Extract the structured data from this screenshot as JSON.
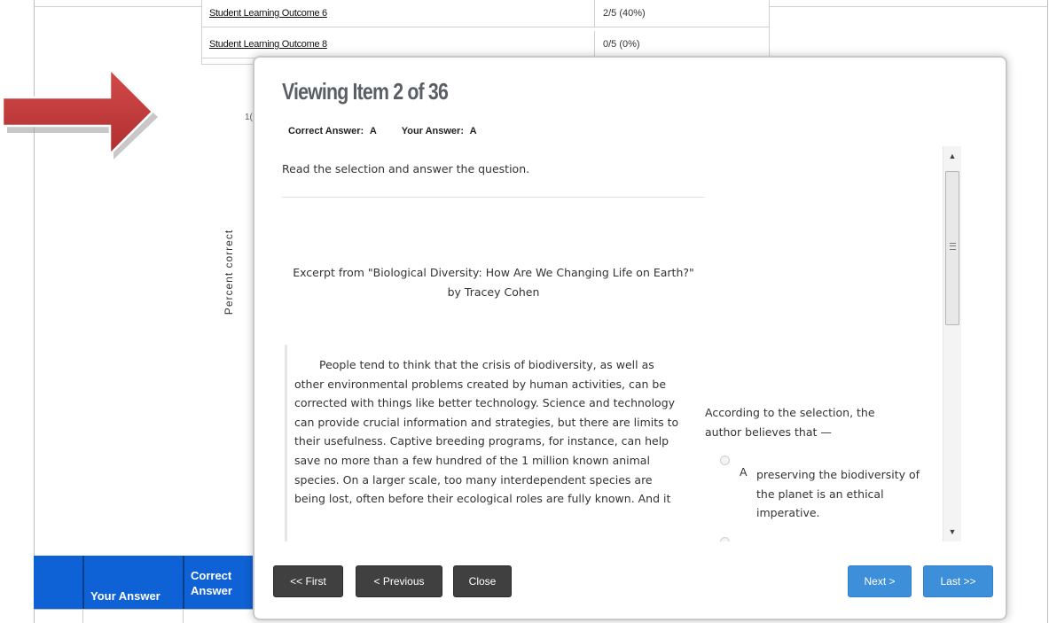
{
  "outcomes": [
    {
      "name": "Student Learning Outcome 6",
      "score": "2/5 (40%)"
    },
    {
      "name": "Student Learning Outcome 8",
      "score": "0/5 (0%)"
    }
  ],
  "chart_fragment": {
    "ylabel": "Percent correct",
    "tick": "1("
  },
  "results_table": {
    "col_your_answer": "Your Answer",
    "col_correct_answer": "Correct Answer"
  },
  "modal": {
    "title": "Viewing Item 2 of 36",
    "correct_answer_label": "Correct Answer:",
    "correct_answer_value": "A",
    "your_answer_label": "Your Answer:",
    "your_answer_value": "A",
    "instruction": "Read the selection and answer the question.",
    "excerpt_title": "Excerpt from \"Biological Diversity: How Are We Changing Life on Earth?\"",
    "excerpt_author": "by Tracey Cohen",
    "passage": "People tend to think that the crisis of biodiversity, as well as other environmental problems created by human activities, can be corrected with things like better technology. Science and technology can provide crucial information and strategies, but there are limits to their usefulness. Captive breeding programs, for instance, can help save no more than a few hundred of the 1 million known animal species. On a larger scale, too many interdependent species are being lost, often before their ecological roles are fully known. And it",
    "question": "According to the selection, the author believes that —",
    "option_a_letter": "A",
    "option_a_text": "preserving the biodiversity of the planet is an ethical imperative.",
    "buttons": {
      "first": "<< First",
      "previous": "< Previous",
      "close": "Close",
      "next": "Next >",
      "last": "Last >>"
    }
  },
  "colors": {
    "header_blue": "#0f62d6",
    "button_dark": "#404040",
    "button_blue": "#3d8fd9",
    "arrow_red": "#c0393a"
  }
}
